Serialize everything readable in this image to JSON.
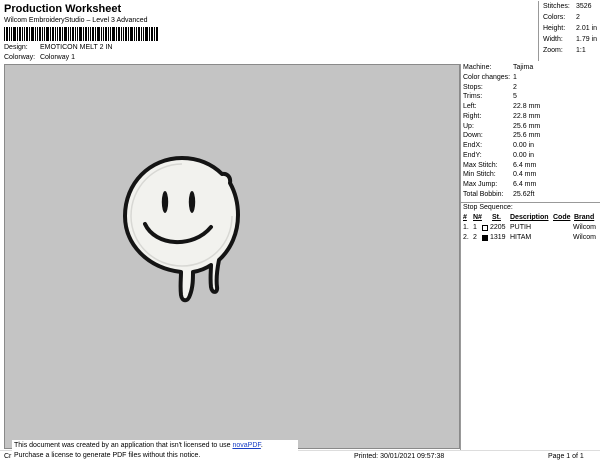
{
  "header": {
    "title": "Production Worksheet",
    "subtitle": "Wilcom EmbroideryStudio – Level 3 Advanced",
    "design_label": "Design:",
    "design_value": "EMOTICON MELT 2 IN",
    "colorway_label": "Colorway:",
    "colorway_value": "Colorway 1"
  },
  "summary": [
    {
      "label": "Stitches:",
      "value": "3526"
    },
    {
      "label": "Colors:",
      "value": "2"
    },
    {
      "label": "Height:",
      "value": "2.01 in"
    },
    {
      "label": "Width:",
      "value": "1.79 in"
    },
    {
      "label": "Zoom:",
      "value": "1:1"
    }
  ],
  "machine_stats": [
    {
      "label": "Machine:",
      "value": "Tajima"
    },
    {
      "label": "Color changes:",
      "value": "1"
    },
    {
      "label": "Stops:",
      "value": "2"
    },
    {
      "label": "Trims:",
      "value": "5"
    },
    {
      "label": "Left:",
      "value": "22.8 mm"
    },
    {
      "label": "Right:",
      "value": "22.8 mm"
    },
    {
      "label": "Up:",
      "value": "25.6 mm"
    },
    {
      "label": "Down:",
      "value": "25.6 mm"
    },
    {
      "label": "EndX:",
      "value": "0.00 in"
    },
    {
      "label": "EndY:",
      "value": "0.00 in"
    },
    {
      "label": "Max Stitch:",
      "value": "6.4 mm"
    },
    {
      "label": "Min Stitch:",
      "value": "0.4 mm"
    },
    {
      "label": "Max Jump:",
      "value": "6.4 mm"
    },
    {
      "label": "Total Bobbin:",
      "value": "25.62ft"
    }
  ],
  "stop_sequence": {
    "title": "Stop Sequence:",
    "headers": {
      "num": "#",
      "n": "N#",
      "st": "St.",
      "description": "Description",
      "code": "Code",
      "brand": "Brand"
    },
    "rows": [
      {
        "num": "1.",
        "n": "1",
        "color": "#ffffff",
        "st": "2205",
        "description": "PUTIH",
        "code": "",
        "brand": "Wilcom"
      },
      {
        "num": "2.",
        "n": "2",
        "color": "#000000",
        "st": "1319",
        "description": "HITAM",
        "code": "",
        "brand": "Wilcom"
      }
    ]
  },
  "footer": {
    "left_fragment": "Cr",
    "notice_line1_prefix": "This document was created by an application that isn't licensed to use ",
    "notice_link": "novaPDF",
    "notice_line1_suffix": ".",
    "notice_line2": "Purchase a license to generate PDF files without this notice.",
    "printed": "Printed: 30/01/2021 09:57:38",
    "page": "Page 1 of 1"
  },
  "design_colors": {
    "fill": "#f2f2ee",
    "outline": "#141414",
    "canvas": "#c4c4c4"
  }
}
